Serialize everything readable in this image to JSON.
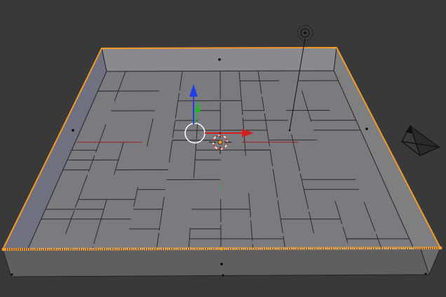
{
  "app": {
    "name": "",
    "view": ""
  },
  "colors": {
    "background": "#393939",
    "floor": "#7b7b7f",
    "floor_line": "#2b2b2b",
    "wall_inner": "#8a8a8e",
    "wall_front": "#666669",
    "wall_shadow": "#6f7080",
    "selection_outline": "#f29a26",
    "axis_x": "#d02020",
    "axis_y": "#2fb02f",
    "axis_z": "#2040e0",
    "cursor_ring": "#cc2222"
  },
  "icons": [
    "light-lamp-icon",
    "camera-icon",
    "3d-cursor-icon",
    "object-origin-icon",
    "manipulator-circle-icon"
  ],
  "selection": {
    "object_selected": true
  }
}
